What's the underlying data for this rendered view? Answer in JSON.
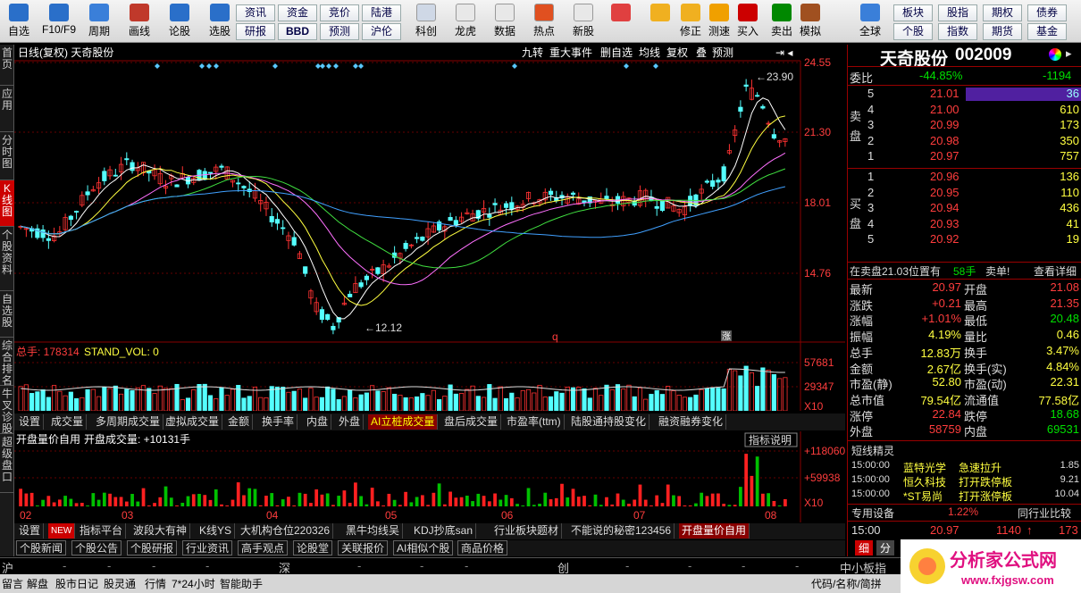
{
  "toolbar": {
    "big": [
      {
        "label": "自选"
      },
      {
        "label": "F10/F9"
      },
      {
        "label": "周期"
      },
      {
        "label": "画线"
      },
      {
        "label": "论股"
      },
      {
        "label": "选股"
      }
    ],
    "mid_top": [
      "资讯",
      "资金",
      "竞价",
      "陆港"
    ],
    "mid_bot": [
      "研报",
      "BBD",
      "预测",
      "沪伦"
    ],
    "icons2": [
      {
        "label": "科创"
      },
      {
        "label": "龙虎"
      },
      {
        "label": "数据"
      },
      {
        "label": "热点"
      },
      {
        "label": "新股"
      }
    ],
    "icons3": [
      {
        "label": ""
      },
      {
        "label": ""
      },
      {
        "label": "修正"
      },
      {
        "label": "测速"
      },
      {
        "label": "买入"
      },
      {
        "label": "卖出"
      },
      {
        "label": "模拟"
      },
      {
        "label": "全球"
      }
    ],
    "right_top": [
      "板块",
      "股指",
      "期权",
      "债券"
    ],
    "right_bot": [
      "个股",
      "指数",
      "期货",
      "基金"
    ]
  },
  "leftnav": [
    "首页",
    "应用",
    "分时图",
    "K线图",
    "个股资料",
    "自选股",
    "综合排名",
    "牛叉诊股",
    "超级盘口"
  ],
  "kheader": {
    "title": "日线(复权) 天奇股份",
    "buttons": [
      "九转",
      "重大事件",
      "删自选",
      "均线",
      "复权",
      "叠",
      "预测"
    ]
  },
  "price_axis": [
    "24.55",
    "21.30",
    "18.01",
    "14.76"
  ],
  "vol_axis": [
    "57681",
    "29347",
    "X10"
  ],
  "ind_axis": [
    "+118060",
    "+59938",
    "X10"
  ],
  "annot": {
    "high": "23.90",
    "low": "12.12",
    "q": "q",
    "zhang": "涨"
  },
  "vol_header": {
    "label": "总手: 178314",
    "label2": "STAND_VOL: 0"
  },
  "tabs1": [
    "设置",
    "成交量",
    "多周期成交量",
    "虚拟成交量",
    "金额",
    "换手率",
    "内盘",
    "外盘",
    "AI立桩成交量",
    "盘后成交量",
    "市盈率(ttm)",
    "陆股通持股变化",
    "融资融券变化"
  ],
  "ind_header": {
    "label": "开盘量价自用",
    "value": "开盘成交量: +10131手",
    "explain": "指标说明"
  },
  "months": [
    "02",
    "03",
    "04",
    "05",
    "06",
    "07",
    "08"
  ],
  "tabs2": [
    "设置",
    "NEW",
    "指标平台",
    "波段大有神",
    "K线YS",
    "大机构仓位220326",
    "黑牛均线吴",
    "KDJ抄底san",
    "行业板块题材",
    "不能说的秘密123456",
    "开盘量价自用"
  ],
  "tabs3": [
    "个股新闻",
    "个股公告",
    "个股研报",
    "行业资讯",
    "高手观点",
    "论股堂",
    "关联报价",
    "AI相似个股",
    "商品价格"
  ],
  "right": {
    "name": "天奇股份",
    "code": "002009",
    "weibi": {
      "label": "委比",
      "pct": "-44.85%",
      "diff": "-1194"
    },
    "sell_label": "卖盘",
    "buy_label": "买盘",
    "sells": [
      {
        "n": "5",
        "p": "21.01",
        "v": "36"
      },
      {
        "n": "4",
        "p": "21.00",
        "v": "610"
      },
      {
        "n": "3",
        "p": "20.99",
        "v": "173"
      },
      {
        "n": "2",
        "p": "20.98",
        "v": "350"
      },
      {
        "n": "1",
        "p": "20.97",
        "v": "757"
      }
    ],
    "buys": [
      {
        "n": "1",
        "p": "20.96",
        "v": "136"
      },
      {
        "n": "2",
        "p": "20.95",
        "v": "110"
      },
      {
        "n": "3",
        "p": "20.94",
        "v": "436"
      },
      {
        "n": "4",
        "p": "20.93",
        "v": "41"
      },
      {
        "n": "5",
        "p": "20.92",
        "v": "19"
      }
    ],
    "notice": {
      "a": "在卖盘21.03位置有",
      "b": "58手",
      "c": "卖单!",
      "d": "查看详细"
    },
    "stats": [
      {
        "l": "最新",
        "v": "20.97",
        "l2": "开盘",
        "v2": "21.08"
      },
      {
        "l": "涨跌",
        "v": "+0.21",
        "l2": "最高",
        "v2": "21.35"
      },
      {
        "l": "涨幅",
        "v": "+1.01%",
        "l2": "最低",
        "v2": "20.48"
      },
      {
        "l": "振幅",
        "v": "4.19%",
        "l2": "量比",
        "v2": "0.46"
      },
      {
        "l": "总手",
        "v": "12.83万",
        "l2": "换手",
        "v2": "3.47%"
      },
      {
        "l": "金额",
        "v": "2.67亿",
        "l2": "换手(实)",
        "v2": "4.84%"
      },
      {
        "l": "市盈(静)",
        "v": "52.80",
        "l2": "市盈(动)",
        "v2": "22.31"
      },
      {
        "l": "总市值",
        "v": "79.54亿",
        "l2": "流通值",
        "v2": "77.58亿"
      },
      {
        "l": "涨停",
        "v": "22.84",
        "l2": "跌停",
        "v2": "18.68"
      },
      {
        "l": "外盘",
        "v": "58759",
        "l2": "内盘",
        "v2": "69531"
      }
    ],
    "short_title": "短线精灵",
    "short": [
      {
        "t": "15:00:00",
        "s": "蓝特光学",
        "e": "急速拉升",
        "v": "1.85"
      },
      {
        "t": "15:00:00",
        "s": "恒久科技",
        "e": "打开跌停板",
        "v": "9.21"
      },
      {
        "t": "15:00:00",
        "s": "*ST易尚",
        "e": "打开涨停板",
        "v": "10.04"
      }
    ],
    "sector": {
      "a": "专用设备",
      "b": "1.22%",
      "c": "同行业比较"
    },
    "last": {
      "t": "15:00",
      "p": "20.97",
      "v": "1140",
      "v2": "173"
    },
    "tabs": [
      "细",
      "分"
    ]
  },
  "ticker": [
    "沪",
    "深",
    "创",
    "中小板指"
  ],
  "bottom": [
    "留言",
    "解盘",
    "股市日记",
    "股灵通",
    "行情",
    "7*24小时",
    "智能助手",
    "代码/名称/简拼"
  ],
  "logo": {
    "text": "分析家公式网",
    "url": "www.fxjgsw.com"
  }
}
